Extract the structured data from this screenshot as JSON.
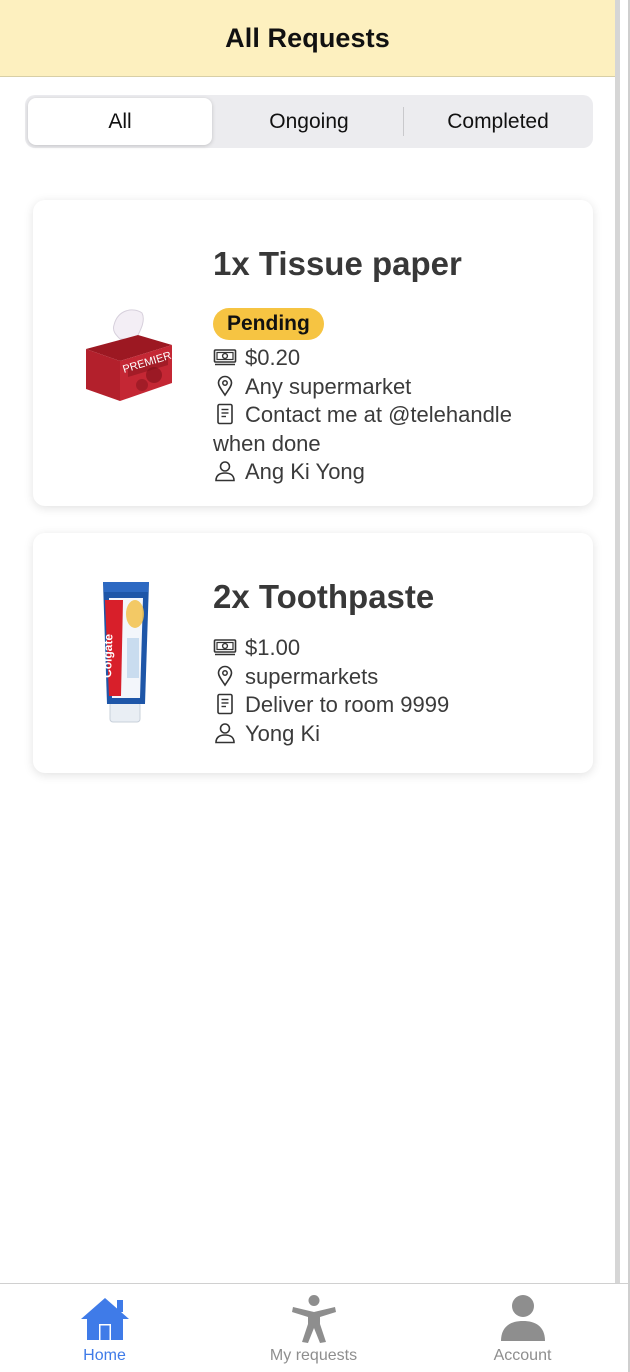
{
  "header": {
    "title": "All Requests"
  },
  "segments": {
    "all": "All",
    "ongoing": "Ongoing",
    "completed": "Completed",
    "selected": "All"
  },
  "requests": [
    {
      "title": "1x Tissue paper",
      "status": "Pending",
      "price": "$0.20",
      "location": "Any supermarket",
      "note": "Contact me at @telehandle when done",
      "requester": "Ang Ki Yong",
      "image": "tissue-box-image",
      "image_text": "PREMIER"
    },
    {
      "title": "2x Toothpaste",
      "price": "$1.00",
      "location": "supermarkets",
      "note": "Deliver to room 9999",
      "requester": "Yong Ki",
      "image": "toothpaste-tube-image",
      "image_text": "Colgate"
    }
  ],
  "tabbar": {
    "items": [
      {
        "label": "Home",
        "icon": "home-icon",
        "active": true
      },
      {
        "label": "My requests",
        "icon": "accessibility-person-icon",
        "active": false
      },
      {
        "label": "Account",
        "icon": "account-icon",
        "active": false
      }
    ]
  },
  "colors": {
    "header_bg": "#fdf0bf",
    "badge_pending": "#f6c442",
    "tab_active": "#3f7be8",
    "tab_inactive": "#8e8e8e"
  }
}
